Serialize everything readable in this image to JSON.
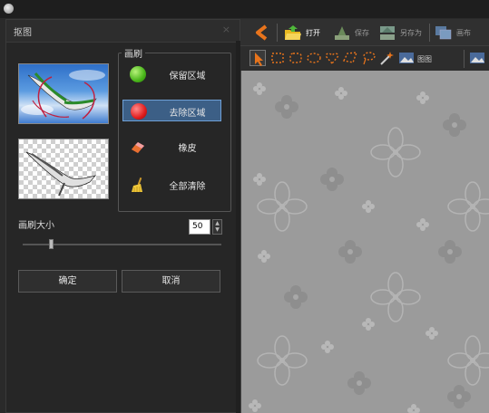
{
  "dialog": {
    "title": "抠图",
    "close_symbol": "×"
  },
  "brush": {
    "group_label": "画刷",
    "tools": [
      {
        "label": "保留区域",
        "icon": "green-ball-icon",
        "selected": false
      },
      {
        "label": "去除区域",
        "icon": "red-ball-icon",
        "selected": true
      },
      {
        "label": "橡皮",
        "icon": "eraser-icon",
        "selected": false
      },
      {
        "label": "全部清除",
        "icon": "broom-icon",
        "selected": false
      }
    ]
  },
  "brush_size": {
    "label": "画刷大小",
    "value": "50",
    "slider_fraction": 0.14
  },
  "buttons": {
    "ok": "确定",
    "cancel": "取消"
  },
  "toolbar": {
    "open": "打开",
    "save": "保存",
    "save_as": "另存为",
    "canvas": "画布",
    "image": "图图"
  },
  "colors": {
    "accent_selected": "#3c5f86",
    "canvas_bg": "#9b9b9b",
    "back_arrow": "#e8741c"
  }
}
